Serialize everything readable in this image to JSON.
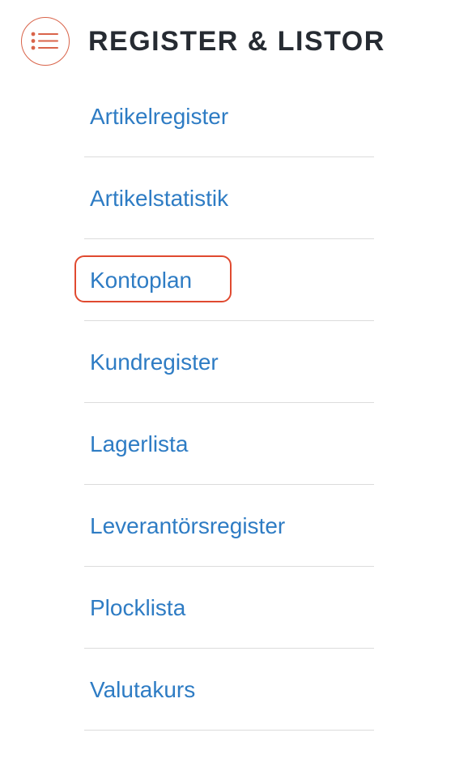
{
  "header": {
    "icon": "list-menu-icon",
    "title": "REGISTER & LISTOR"
  },
  "links": [
    {
      "label": "Artikelregister"
    },
    {
      "label": "Artikelstatistik"
    },
    {
      "label": "Kontoplan",
      "highlighted": true
    },
    {
      "label": "Kundregister"
    },
    {
      "label": "Lagerlista"
    },
    {
      "label": "Leverantörsregister"
    },
    {
      "label": "Plocklista"
    },
    {
      "label": "Valutakurs"
    }
  ],
  "colors": {
    "accent": "#d9644a",
    "link": "#2e7cc4",
    "title": "#262b32",
    "highlight": "#e04a30",
    "divider": "#dcdcdc"
  }
}
